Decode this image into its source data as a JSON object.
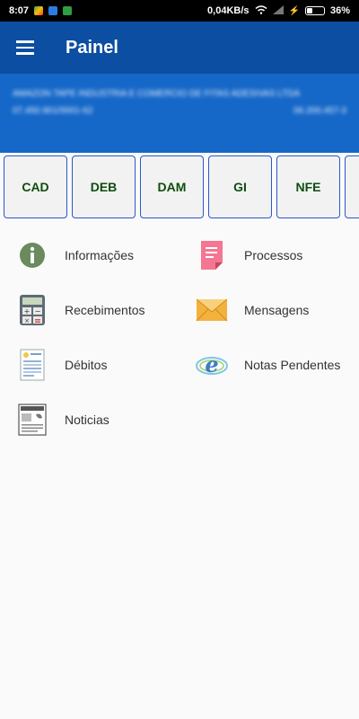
{
  "status_bar": {
    "time": "8:07",
    "network_speed": "0,04KB/s",
    "battery_text": "36%",
    "battery_level": 0.36
  },
  "app_bar": {
    "title": "Painel"
  },
  "account": {
    "company_name": "AMAZON TAPE INDUSTRIA E COMERCIO DE FITAS ADESIVAS LTDA",
    "cnpj": "07.450.901/0001-62",
    "registration": "06.200.457-3"
  },
  "shortcuts": [
    {
      "label": "CAD"
    },
    {
      "label": "DEB"
    },
    {
      "label": "DAM"
    },
    {
      "label": "GI"
    },
    {
      "label": "NFE"
    },
    {
      "label": ""
    }
  ],
  "menu": [
    {
      "label": "Informações",
      "icon": "info-icon"
    },
    {
      "label": "Processos",
      "icon": "document-icon"
    },
    {
      "label": "Recebimentos",
      "icon": "calculator-icon"
    },
    {
      "label": "Mensagens",
      "icon": "envelope-icon"
    },
    {
      "label": "Débitos",
      "icon": "invoice-icon"
    },
    {
      "label": "Notas Pendentes",
      "icon": "e-notes-icon"
    },
    {
      "label": "Noticias",
      "icon": "newspaper-icon"
    }
  ],
  "colors": {
    "app_bar": "#0b4ea2",
    "banner": "#1668c8",
    "shortcut_text": "#0e4d0e",
    "shortcut_border": "#2b58c7"
  }
}
